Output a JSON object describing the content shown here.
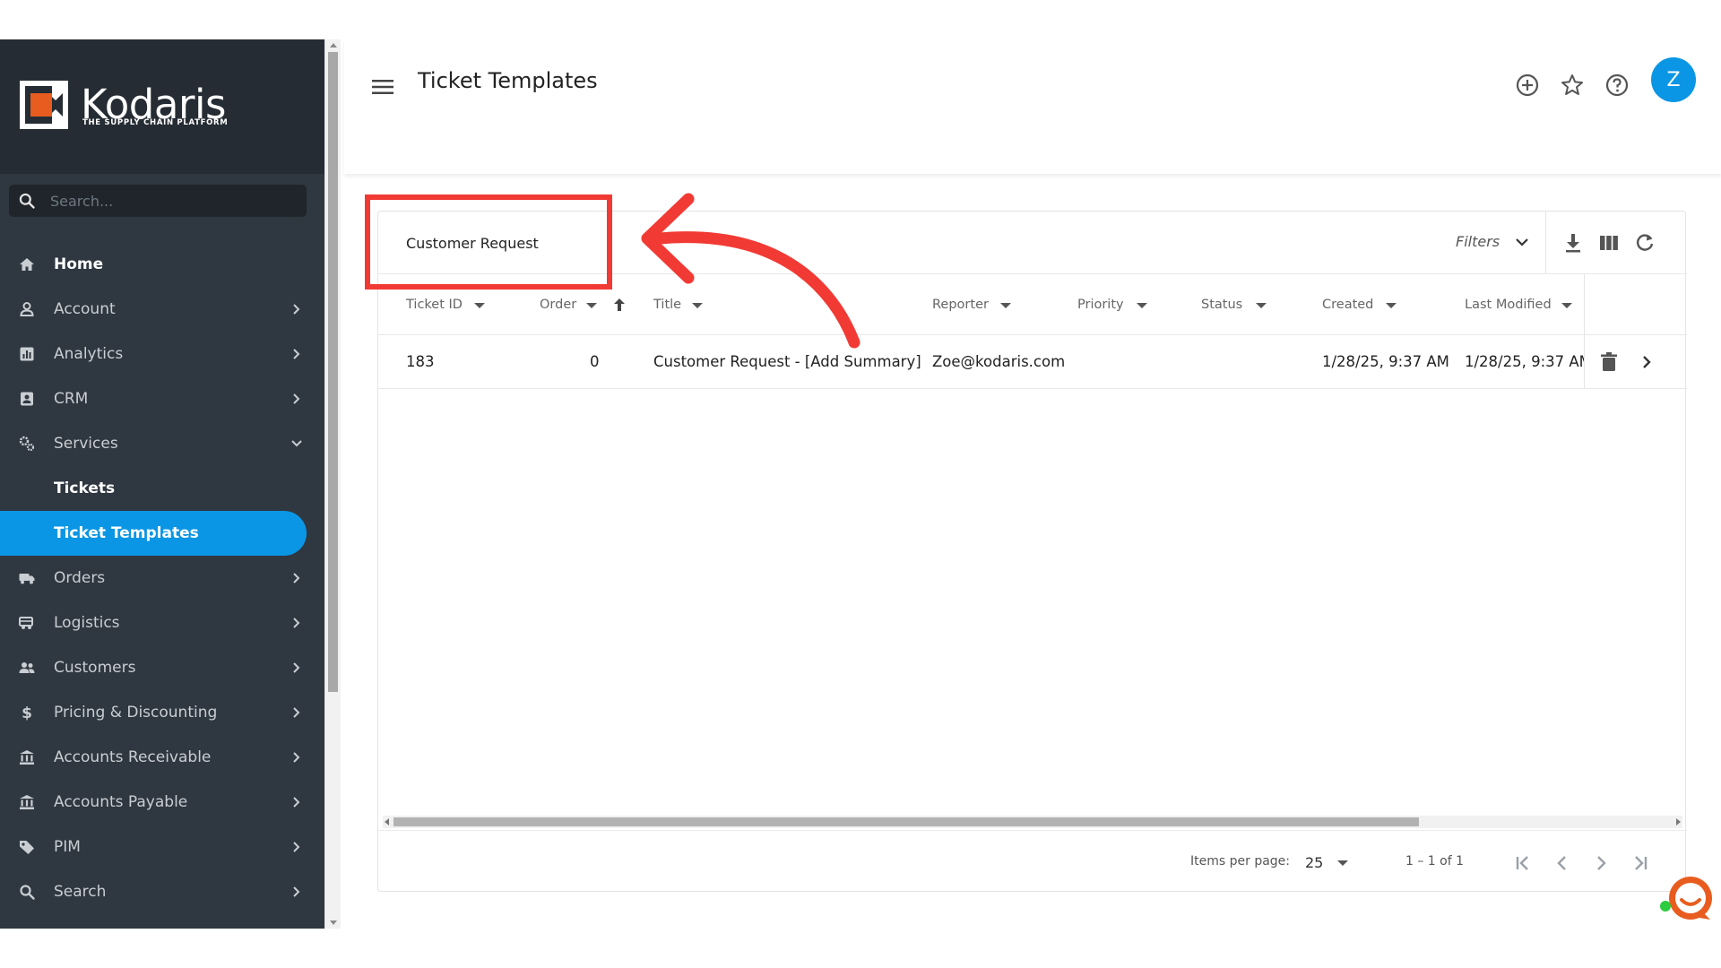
{
  "app": {
    "brand_name": "Kodaris",
    "brand_tagline": "THE SUPPLY CHAIN PLATFORM",
    "accent_color": "#0b96e5",
    "sidebar_color": "#2f3740"
  },
  "sidebar": {
    "search_placeholder": "Search...",
    "items": [
      {
        "label": "Home",
        "icon": "home-icon"
      },
      {
        "label": "Account",
        "icon": "account-icon"
      },
      {
        "label": "Analytics",
        "icon": "analytics-icon"
      },
      {
        "label": "CRM",
        "icon": "crm-icon"
      },
      {
        "label": "Services",
        "icon": "services-icon"
      },
      {
        "label": "Tickets"
      },
      {
        "label": "Ticket Templates"
      },
      {
        "label": "Orders",
        "icon": "truck-icon"
      },
      {
        "label": "Logistics",
        "icon": "logistics-icon"
      },
      {
        "label": "Customers",
        "icon": "customers-icon"
      },
      {
        "label": "Pricing & Discounting",
        "icon": "dollar-icon"
      },
      {
        "label": "Accounts Receivable",
        "icon": "bank-icon"
      },
      {
        "label": "Accounts Payable",
        "icon": "bank-icon"
      },
      {
        "label": "PIM",
        "icon": "tag-icon"
      },
      {
        "label": "Search",
        "icon": "search-icon"
      }
    ]
  },
  "header": {
    "title": "Ticket Templates",
    "avatar_initial": "Z"
  },
  "card": {
    "template_name": "Customer Request",
    "filters_label": "Filters"
  },
  "table": {
    "columns": [
      "Ticket ID",
      "Order",
      "Title",
      "Reporter",
      "Priority",
      "Status",
      "Created",
      "Last Modified"
    ],
    "rows": [
      {
        "ticket_id": "183",
        "order": "0",
        "title": "Customer Request - [Add Summary]",
        "reporter": "Zoe@kodaris.com",
        "priority": "",
        "status": "",
        "created": "1/28/25, 9:37 AM",
        "last_modified": "1/28/25, 9:37 AM"
      }
    ]
  },
  "paginator": {
    "items_per_page_label": "Items per page:",
    "items_per_page_value": "25",
    "range_label": "1 – 1 of 1"
  },
  "annotation": {
    "color": "#f23a34"
  }
}
